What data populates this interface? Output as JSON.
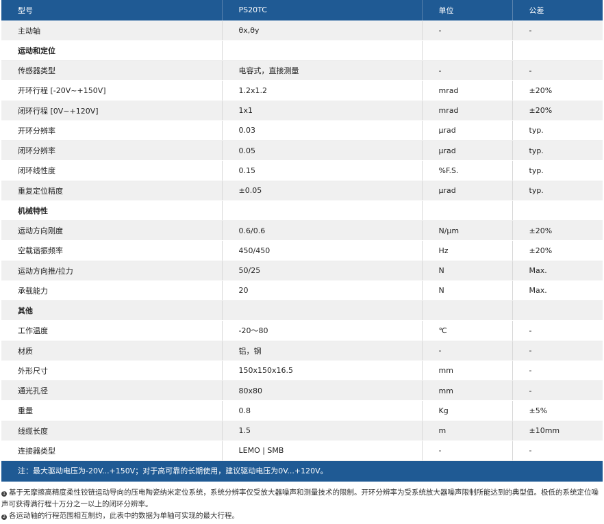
{
  "header": {
    "col1": "型号",
    "col2": "PS20TC",
    "col3": "单位",
    "col4": "公差"
  },
  "rows": [
    {
      "param": "主动轴",
      "value": "θx,θy",
      "unit": "-",
      "tol": "-"
    },
    {
      "param": "运动和定位",
      "value": "",
      "unit": "",
      "tol": ""
    },
    {
      "param": "传感器类型",
      "value": "电容式，直接测量",
      "unit": "-",
      "tol": "-"
    },
    {
      "param": "开环行程 [-20V~+150V]",
      "value": "1.2x1.2",
      "unit": "mrad",
      "tol": "±20%"
    },
    {
      "param": "闭环行程 [0V~+120V]",
      "value": "1x1",
      "unit": "mrad",
      "tol": "±20%"
    },
    {
      "param": "开环分辨率",
      "value": "0.03",
      "unit": "μrad",
      "tol": "typ."
    },
    {
      "param": "闭环分辨率",
      "value": "0.05",
      "unit": "μrad",
      "tol": "typ."
    },
    {
      "param": "闭环线性度",
      "value": "0.15",
      "unit": "%F.S.",
      "tol": "typ."
    },
    {
      "param": "重复定位精度",
      "value": "±0.05",
      "unit": "μrad",
      "tol": "typ."
    },
    {
      "param": "机械特性",
      "value": "",
      "unit": "",
      "tol": ""
    },
    {
      "param": "运动方向刚度",
      "value": "0.6/0.6",
      "unit": "N/μm",
      "tol": "±20%"
    },
    {
      "param": "空载谐振频率",
      "value": "450/450",
      "unit": "Hz",
      "tol": "±20%"
    },
    {
      "param": "运动方向推/拉力",
      "value": "50/25",
      "unit": "N",
      "tol": "Max."
    },
    {
      "param": "承载能力",
      "value": "20",
      "unit": "N",
      "tol": "Max."
    },
    {
      "param": "其他",
      "value": "",
      "unit": "",
      "tol": ""
    },
    {
      "param": "工作温度",
      "value": "-20～80",
      "unit": "℃",
      "tol": "-"
    },
    {
      "param": "材质",
      "value": "铝，钢",
      "unit": "-",
      "tol": "-"
    },
    {
      "param": "外形尺寸",
      "value": "150x150x16.5",
      "unit": "mm",
      "tol": "-"
    },
    {
      "param": "通光孔径",
      "value": "80x80",
      "unit": "mm",
      "tol": "-"
    },
    {
      "param": "重量",
      "value": "0.8",
      "unit": "Kg",
      "tol": "±5%"
    },
    {
      "param": "线缆长度",
      "value": "1.5",
      "unit": "m",
      "tol": "±10mm"
    },
    {
      "param": "连接器类型",
      "value": "LEMO | SMB",
      "unit": "-",
      "tol": "-"
    }
  ],
  "note": "注：最大驱动电压为-20V...+150V；对于高可靠的长期使用，建议驱动电压为0V...+120V。",
  "footnotes": [
    {
      "marker": "1",
      "text": "基于无摩擦高精度柔性铰链运动导向的压电陶瓷纳米定位系统，系统分辨率仅受放大器噪声和测量技术的限制。开环分辨率为受系统放大器噪声限制所能达到的典型值。极低的系统定位噪声可获得满行程十万分之一以上的闭环分辨率。"
    },
    {
      "marker": "2",
      "text": "各运动轴的行程范围相互制约，此表中的数据为单轴可实现的最大行程。"
    }
  ]
}
